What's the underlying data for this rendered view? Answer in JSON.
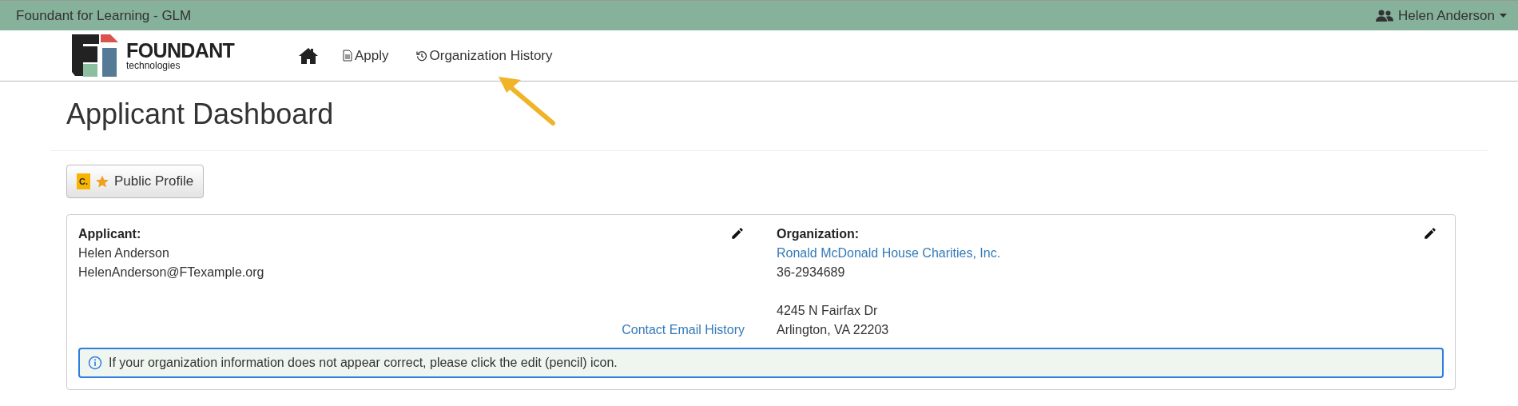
{
  "top_bar": {
    "title": "Foundant for Learning - GLM",
    "user": "Helen Anderson"
  },
  "logo": {
    "name": "FOUNDANT",
    "tagline": "technologies"
  },
  "nav": [
    {
      "label": "Apply"
    },
    {
      "label": "Organization History"
    }
  ],
  "page_title": "Applicant Dashboard",
  "profile_button": {
    "badge": "C.",
    "label": "Public Profile"
  },
  "applicant": {
    "heading": "Applicant:",
    "name": "Helen Anderson",
    "email": "HelenAnderson@FTexample.org",
    "link": "Contact Email History"
  },
  "organization": {
    "heading": "Organization:",
    "name": "Ronald McDonald House Charities, Inc.",
    "ein": "36-2934689",
    "address_line_1": "4245 N Fairfax Dr",
    "address_line_2": "Arlington, VA 22203"
  },
  "notice": "If your organization information does not appear correct, please click the edit (pencil) icon."
}
